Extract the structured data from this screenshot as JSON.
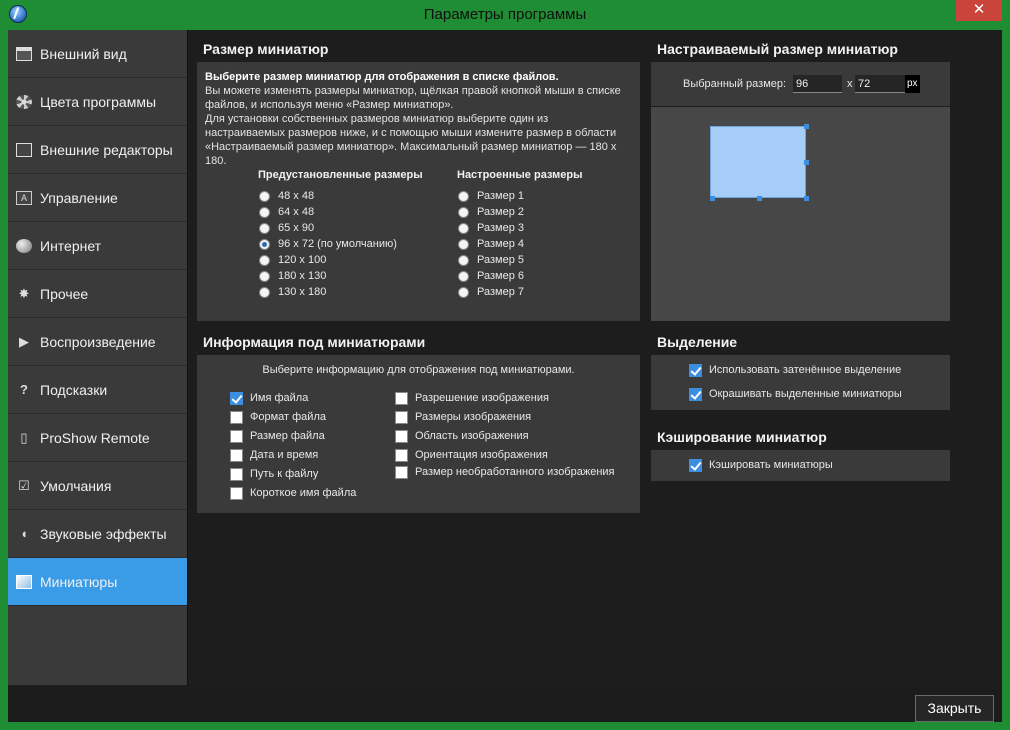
{
  "window": {
    "title": "Параметры программы",
    "close_glyph": "✕"
  },
  "sidebar": {
    "items": [
      {
        "label": "Внешний вид",
        "icon": "window-icon"
      },
      {
        "label": "Цвета программы",
        "icon": "palette-icon"
      },
      {
        "label": "Внешние редакторы",
        "icon": "edit-icon"
      },
      {
        "label": "Управление",
        "icon": "keyboard-icon"
      },
      {
        "label": "Интернет",
        "icon": "globe-icon"
      },
      {
        "label": "Прочее",
        "icon": "gear-icon"
      },
      {
        "label": "Воспроизведение",
        "icon": "play-icon"
      },
      {
        "label": "Подсказки",
        "icon": "question-icon"
      },
      {
        "label": "ProShow Remote",
        "icon": "remote-icon"
      },
      {
        "label": "Умолчания",
        "icon": "checkmark-icon"
      },
      {
        "label": "Звуковые эффекты",
        "icon": "sound-icon"
      },
      {
        "label": "Миниатюры",
        "icon": "thumbnails-icon",
        "active": true
      }
    ],
    "icon_glyphs": {
      "gear": "✸",
      "play": "▶",
      "question": "?",
      "remote": "▯",
      "check": "☑",
      "sound": "◖"
    }
  },
  "thumb_size": {
    "title": "Размер миниатюр",
    "desc_bold": "Выберите размер миниатюр для отображения в списке файлов.",
    "desc_text": "Вы можете изменять размеры миниатюр, щёлкая правой кнопкой мыши в списке файлов, и используя меню «Размер миниатюр».",
    "desc_text2": "Для установки собственных размеров миниатюр выберите один из настраиваемых размеров ниже, и с помощью мыши измените размер в области «Настраиваемый размер миниатюр». Максимальный размер миниатюр — 180 x 180.",
    "preset_head": "Предустановленные размеры",
    "custom_head": "Настроенные размеры",
    "presets": [
      "48 x 48",
      "64 x 48",
      "65 x 90",
      "96 x 72 (по умолчанию)",
      "120 x 100",
      "180 x 130",
      "130 x 180"
    ],
    "presets_selected": 3,
    "customs": [
      "Размер 1",
      "Размер 2",
      "Размер 3",
      "Размер 4",
      "Размер 5",
      "Размер 6",
      "Размер 7"
    ]
  },
  "custom_size": {
    "title": "Настраиваемый размер миниатюр",
    "selected_label": "Выбранный размер:",
    "width": "96",
    "separator": "x",
    "height": "72",
    "unit": "px"
  },
  "info": {
    "title": "Информация под миниатюрами",
    "subtitle": "Выберите информацию для отображения под миниатюрами.",
    "left": [
      {
        "label": "Имя файла",
        "checked": true
      },
      {
        "label": "Формат файла",
        "checked": false
      },
      {
        "label": "Размер файла",
        "checked": false
      },
      {
        "label": "Дата и время",
        "checked": false
      },
      {
        "label": "Путь к файлу",
        "checked": false
      },
      {
        "label": "Короткое имя файла",
        "checked": false
      }
    ],
    "right": [
      {
        "label": "Разрешение изображения",
        "checked": false
      },
      {
        "label": "Размеры изображения",
        "checked": false
      },
      {
        "label": "Область изображения",
        "checked": false
      },
      {
        "label": "Ориентация изображения",
        "checked": false
      },
      {
        "label": "Размер необработанного изображения",
        "checked": false
      }
    ]
  },
  "selection": {
    "title": "Выделение",
    "options": [
      {
        "label": "Использовать затенённое выделение",
        "checked": true
      },
      {
        "label": "Окрашивать выделенные миниатюры",
        "checked": true
      }
    ]
  },
  "cache": {
    "title": "Кэширование миниатюр",
    "options": [
      {
        "label": "Кэшировать миниатюры",
        "checked": true
      }
    ]
  },
  "footer": {
    "close_label": "Закрыть"
  },
  "colors": {
    "accent": "#3a9be6",
    "titlebar": "#1f8d33",
    "panel": "#3a3a3a"
  }
}
